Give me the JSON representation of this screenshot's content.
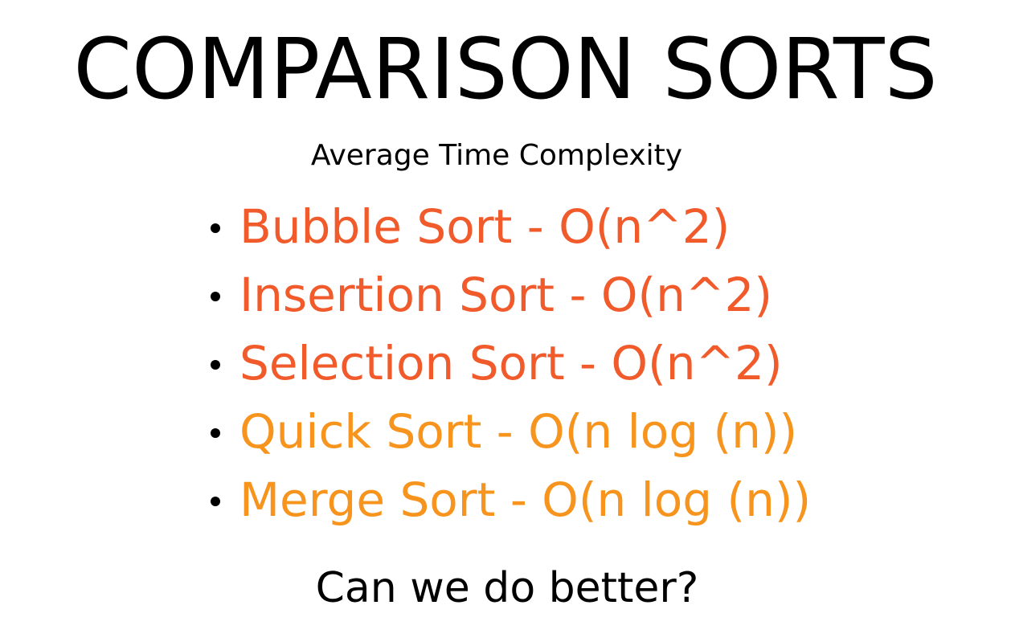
{
  "title": "COMPARISON SORTS",
  "subtitle": "Average Time Complexity",
  "colors": {
    "quadratic": "#f15a2b",
    "linearithmic": "#f7941d",
    "text": "#000000"
  },
  "sorts": [
    {
      "label": "Bubble Sort - O(n^2)",
      "color": "#f15a2b"
    },
    {
      "label": "Insertion Sort - O(n^2)",
      "color": "#f15a2b"
    },
    {
      "label": "Selection Sort - O(n^2)",
      "color": "#f15a2b"
    },
    {
      "label": "Quick Sort - O(n log (n))",
      "color": "#f7941d"
    },
    {
      "label": "Merge Sort - O(n log (n))",
      "color": "#f7941d"
    }
  ],
  "closing": "Can we do better?"
}
